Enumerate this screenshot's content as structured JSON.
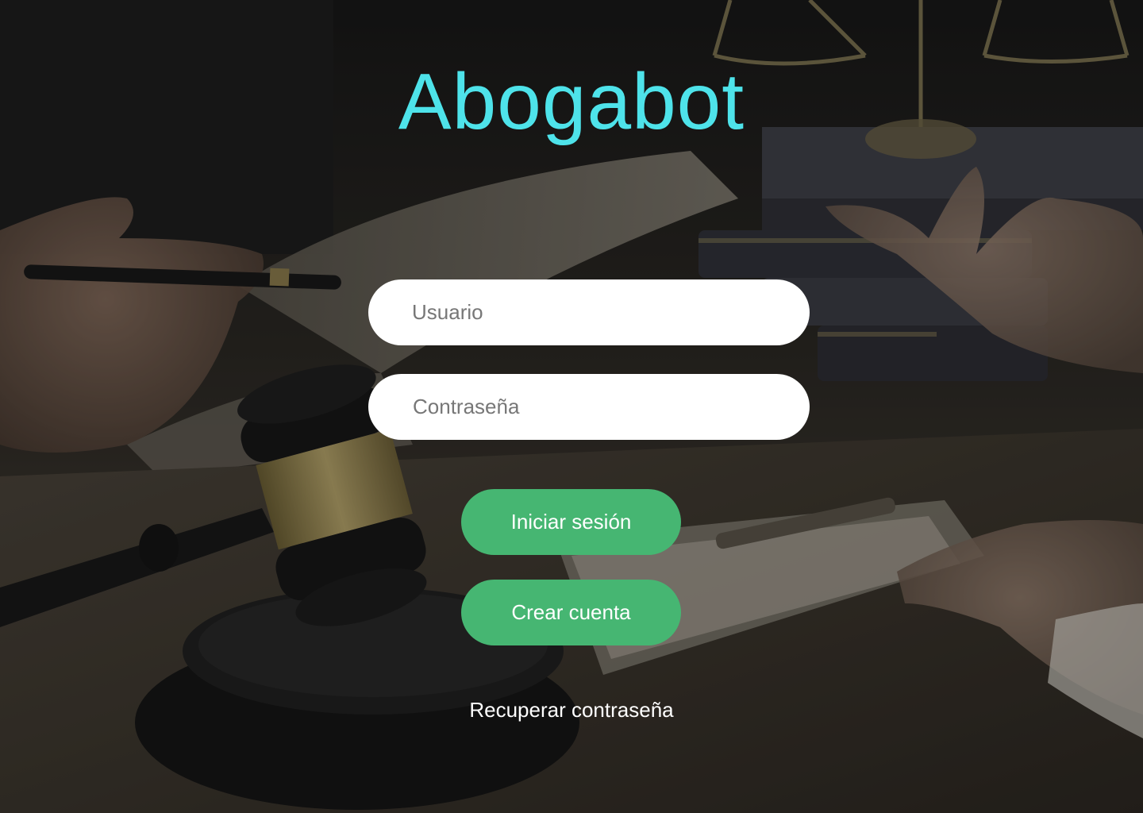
{
  "app": {
    "title": "Abogabot",
    "accent_color": "#4ee3ea"
  },
  "login_form": {
    "username": {
      "value": "",
      "placeholder": "Usuario"
    },
    "password": {
      "value": "",
      "placeholder": "Contraseña"
    },
    "login_button_label": "Iniciar sesión",
    "create_account_button_label": "Crear cuenta",
    "button_color": "#46b672",
    "recover_password_link": "Recuperar contraseña"
  },
  "background": {
    "description_icon": "courtroom-gavel-photo"
  }
}
